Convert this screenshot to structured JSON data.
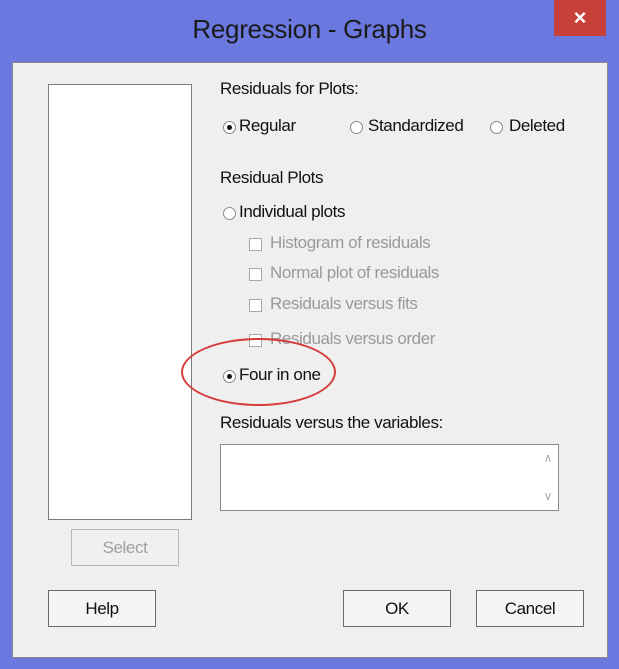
{
  "window": {
    "title": "Regression - Graphs",
    "close_glyph": "×"
  },
  "residuals_for_plots": {
    "label": "Residuals for Plots:",
    "options": [
      {
        "label": "Regular",
        "selected": true
      },
      {
        "label": "Standardized",
        "selected": false
      },
      {
        "label": "Deleted",
        "selected": false
      }
    ]
  },
  "residual_plots": {
    "label": "Residual Plots",
    "individual_label": "Individual plots",
    "individual_selected": false,
    "checkboxes": [
      {
        "label": "Histogram of residuals",
        "checked": false,
        "enabled": false
      },
      {
        "label": "Normal plot of residuals",
        "checked": false,
        "enabled": false
      },
      {
        "label": "Residuals versus fits",
        "checked": false,
        "enabled": false
      },
      {
        "label": "Residuals versus order",
        "checked": false,
        "enabled": false
      }
    ],
    "four_in_one_label": "Four in one",
    "four_in_one_selected": true
  },
  "residuals_vs_variables": {
    "label": "Residuals versus the variables:",
    "value": ""
  },
  "buttons": {
    "select": "Select",
    "help": "Help",
    "ok": "OK",
    "cancel": "Cancel"
  },
  "annotation": {
    "color": "#d63a3a"
  }
}
